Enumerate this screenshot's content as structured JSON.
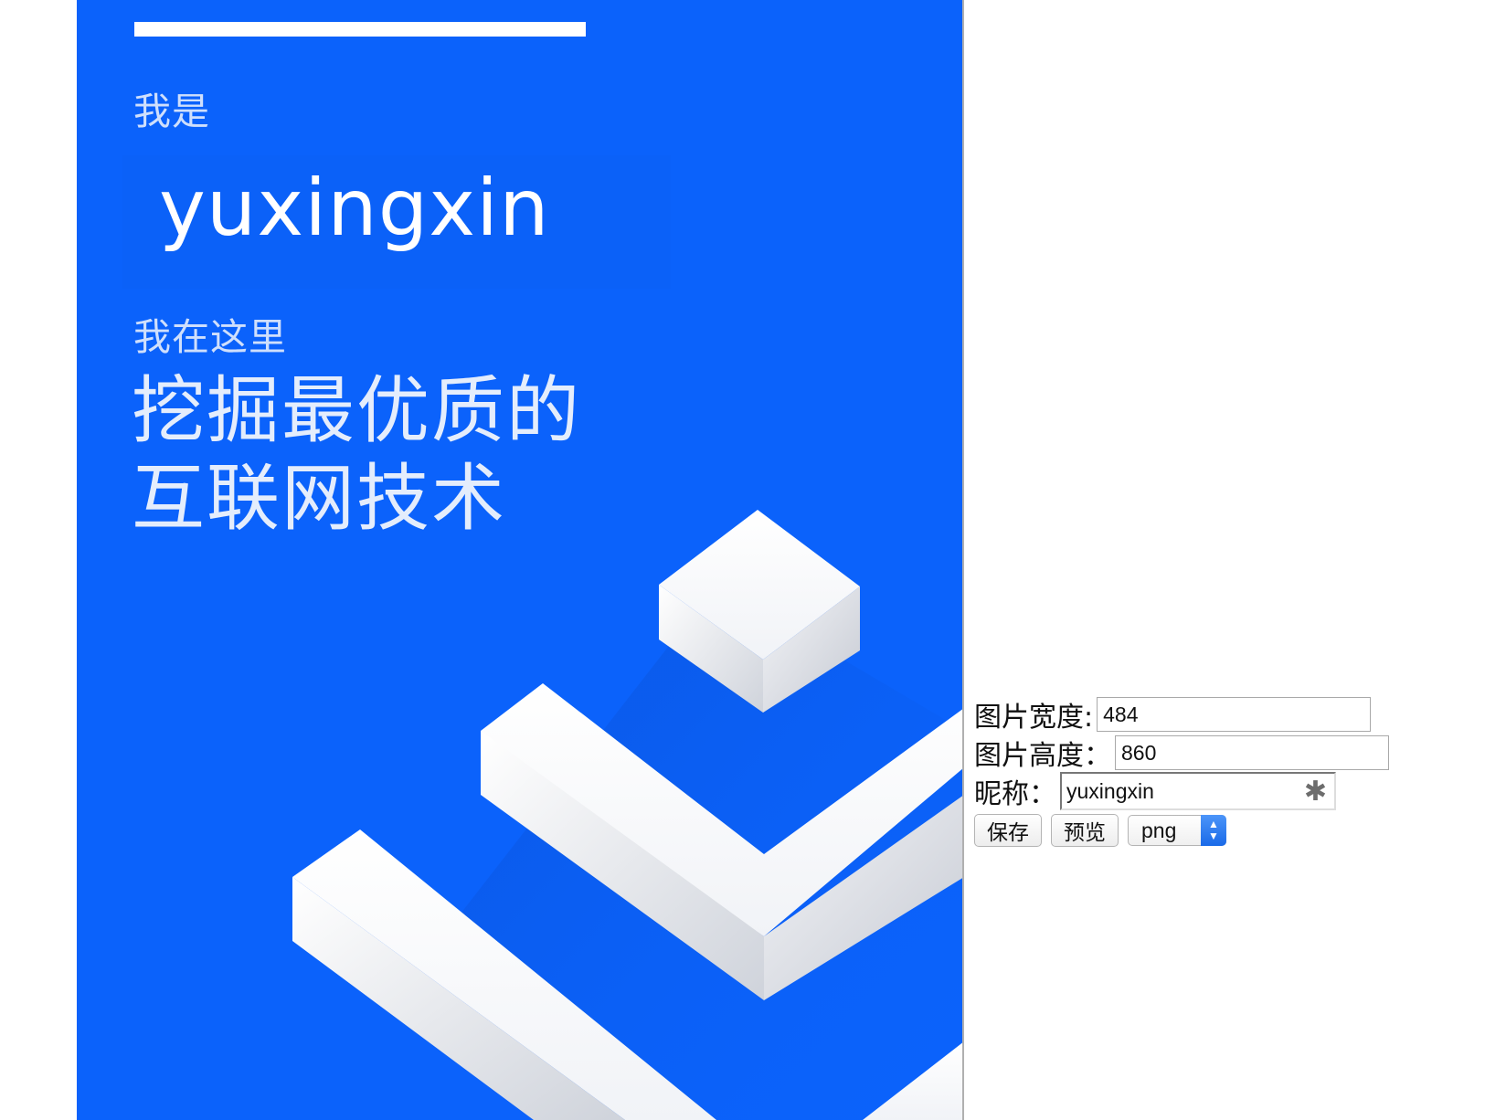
{
  "poster": {
    "line1": "我是",
    "nickname": "yuxingxin",
    "line2": "我在这里",
    "headline_1": "挖掘最优质的",
    "headline_2": "互联网技术",
    "bg_color": "#0b62fb"
  },
  "form": {
    "width_label": "图片宽度:",
    "width_value": "484",
    "height_label": "图片高度：",
    "height_value": "860",
    "nickname_label": "昵称：",
    "nickname_value": "yuxingxin",
    "nickname_icon": "asterisk-icon",
    "save_label": "保存",
    "preview_label": "预览",
    "format_selected": "png"
  }
}
